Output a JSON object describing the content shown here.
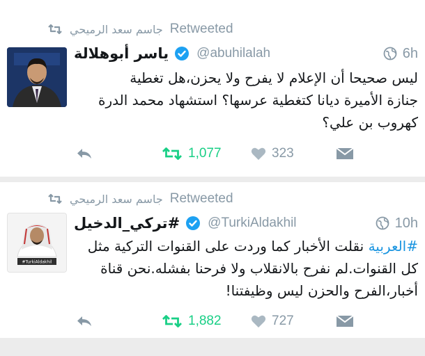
{
  "tweets": [
    {
      "retweeted_by": "جاسم سعد الرميحي",
      "retweeted_label": "Retweeted",
      "name": "ياسر أبوهلالة",
      "handle": "@abuhilalah",
      "time": "6h",
      "text_lines": [
        "ليس صحيحا أن الإعلام لا يفرح ولا يحزن،هل تغطية",
        "جنازة الأميرة ديانا كتغطية عرسها؟ استشهاد محمد الدرة",
        "كهروب بن علي؟"
      ],
      "retweets": "1,077",
      "likes": "323"
    },
    {
      "retweeted_by": "جاسم سعد الرميحي",
      "retweeted_label": "Retweeted",
      "name": "#تركي_الدخيل",
      "handle": "@TurkiAldakhil",
      "time": "10h",
      "hashtag": "#العربية",
      "text_lines": [
        "نقلت الأخبار كما وردت على القنوات التركية مثل",
        "كل القنوات.لم نفرح بالانقلاب ولا فرحنا بفشله.نحن قناة",
        "أخبار،الفرح والحزن ليس وظيفتنا!"
      ],
      "retweets": "1,882",
      "likes": "727",
      "avatar_caption": "#TurkiAldakhil"
    }
  ],
  "colors": {
    "retweet_green": "#19cf86",
    "muted_gray": "#8899a6",
    "verified_blue": "#1da1f2",
    "hashtag_blue": "#1b95e0",
    "text": "#14171a"
  },
  "icons": [
    "retweet-icon",
    "verified-icon",
    "globe-icon",
    "reply-icon",
    "heart-icon",
    "direct-message-icon"
  ]
}
